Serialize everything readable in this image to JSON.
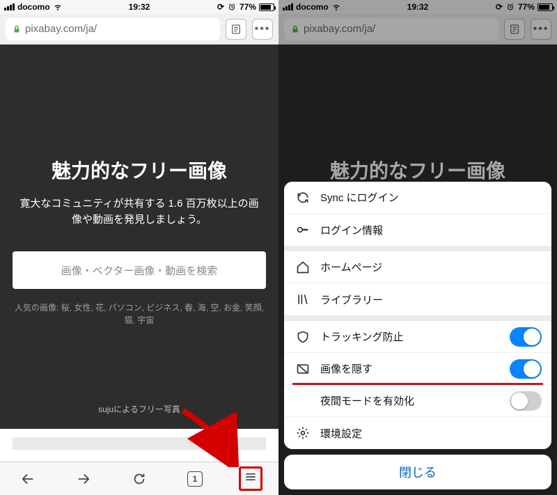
{
  "status": {
    "carrier": "docomo",
    "time": "19:32",
    "battery_pct": "77%"
  },
  "url": "pixabay.com/ja/",
  "page": {
    "headline": "魅力的なフリー画像",
    "subhead": "寛大なコミュニティが共有する 1.6 百万枚以上の画像や動画を発見しましょう。",
    "search_placeholder": "画像・ベクター画像・動画を検索",
    "popular": "人気の画像: 桜, 女性, 花, パソコン, ビジネス, 春, 海, 空, お金, 笑顔, 猫, 宇宙",
    "credit": "sujuによるフリー写真"
  },
  "toolbar": {
    "tab_count": "1"
  },
  "menu": {
    "sync_login": "Sync にログイン",
    "login_info": "ログイン情報",
    "homepage": "ホームページ",
    "library": "ライブラリー",
    "tracking": "トラッキング防止",
    "hide_images": "画像を隠す",
    "night_mode": "夜間モードを有効化",
    "settings": "環境設定",
    "close": "閉じる",
    "tracking_on": true,
    "hide_images_on": true,
    "night_mode_on": false
  }
}
